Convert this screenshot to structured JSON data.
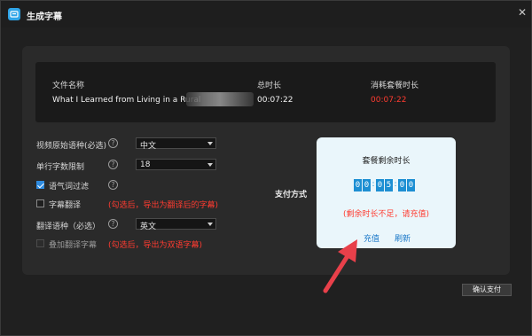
{
  "window": {
    "title": "生成字幕",
    "close_icon": "close-icon"
  },
  "file_table": {
    "headers": {
      "name": "文件名称",
      "duration": "总时长",
      "consume": "消耗套餐时长"
    },
    "row": {
      "name": "What I Learned from Living in a Rural",
      "duration": "00:07:22",
      "consume": "00:07:22"
    }
  },
  "form": {
    "source_lang_label": "视频原始语种(必选)",
    "source_lang_value": "中文",
    "chars_label": "单行字数限制",
    "chars_value": "18",
    "filter_label": "语气词过滤",
    "filter_checked": true,
    "translate_label": "字幕翻译",
    "translate_checked": false,
    "translate_hint": "(勾选后，导出为翻译后的字幕)",
    "target_lang_label": "翻译语种（必选）",
    "target_lang_value": "英文",
    "overlay_label": "叠加翻译字幕",
    "overlay_checked": false,
    "overlay_hint": "(勾选后，导出为双语字幕)"
  },
  "payment": {
    "label": "支付方式"
  },
  "popup": {
    "title": "套餐剩余时长",
    "digits": [
      "0",
      "0",
      "0",
      "5",
      "0",
      "0"
    ],
    "warning": "(剩余时长不足，请充值)",
    "recharge": "充值",
    "refresh": "刷新"
  },
  "confirm_button": "确认支付",
  "colors": {
    "accent": "#2e8be0",
    "warning": "#ff3b30",
    "popup_bg": "#eaf6fb",
    "arrow": "#e8404a"
  }
}
